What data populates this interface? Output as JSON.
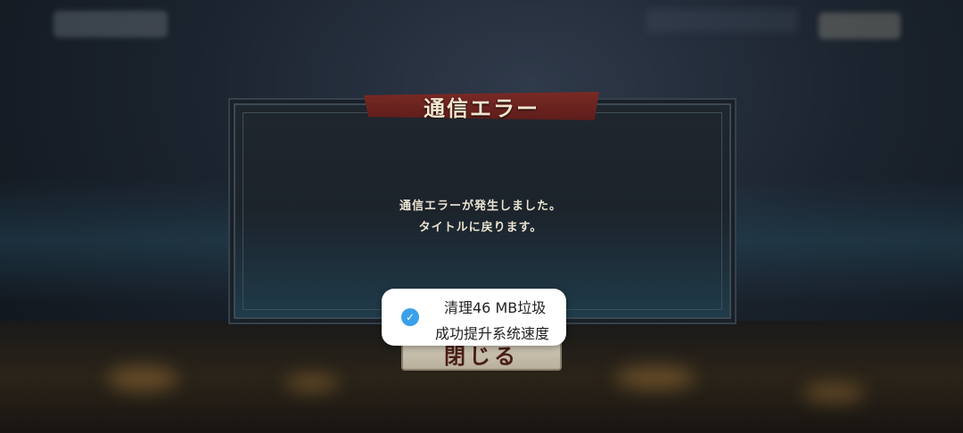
{
  "dialog": {
    "title": "通信エラー",
    "message_line1": "通信エラーが発生しました。",
    "message_line2": "タイトルに戻ります。",
    "close_label": "閉じる"
  },
  "toast": {
    "icon": "check-icon",
    "line1": "清理46 MB垃圾",
    "line2": "成功提升系统速度"
  },
  "colors": {
    "banner": "#7a2a25",
    "toast_icon": "#3ba0ea",
    "dialog_bg": "#1c232b"
  }
}
